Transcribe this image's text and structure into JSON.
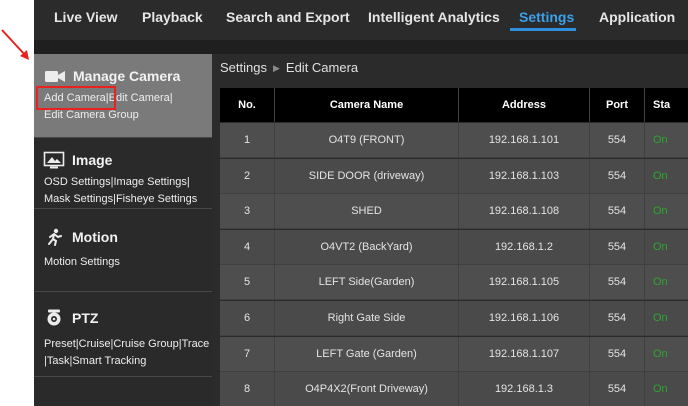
{
  "nav": {
    "items": [
      {
        "label": "Live View",
        "active": false
      },
      {
        "label": "Playback",
        "active": false
      },
      {
        "label": "Search and Export",
        "active": false
      },
      {
        "label": "Intelligent Analytics",
        "active": false
      },
      {
        "label": "Settings",
        "active": true
      },
      {
        "label": "Application",
        "active": false
      }
    ],
    "accent_color": "#2f8fdc"
  },
  "sidebar": {
    "sections": [
      {
        "title": "Manage Camera",
        "icon": "camera-icon",
        "active": true,
        "links": [
          "Add Camera",
          "Edit Camera",
          "Edit Camera Group"
        ]
      },
      {
        "title": "Image",
        "icon": "image-icon",
        "active": false,
        "links": [
          "OSD Settings",
          "Image Settings",
          "Mask Settings",
          "Fisheye Settings"
        ]
      },
      {
        "title": "Motion",
        "icon": "running-person-icon",
        "active": false,
        "links": [
          "Motion Settings"
        ]
      },
      {
        "title": "PTZ",
        "icon": "ptz-camera-icon",
        "active": false,
        "links": [
          "Preset",
          "Cruise",
          "Cruise Group",
          "Trace",
          "Task",
          "Smart Tracking"
        ]
      }
    ]
  },
  "breadcrumb": {
    "root": "Settings",
    "separator": "▶",
    "current": "Edit Camera"
  },
  "table": {
    "headers": [
      "No.",
      "Camera Name",
      "Address",
      "Port",
      "Sta"
    ],
    "rows": [
      {
        "no": "1",
        "name": "O4T9 (FRONT)",
        "address": "192.168.1.101",
        "port": "554",
        "status": "On"
      },
      {
        "no": "2",
        "name": "SIDE DOOR (driveway)",
        "address": "192.168.1.103",
        "port": "554",
        "status": "On"
      },
      {
        "no": "3",
        "name": "SHED",
        "address": "192.168.1.108",
        "port": "554",
        "status": "On"
      },
      {
        "no": "4",
        "name": "O4VT2 (BackYard)",
        "address": "192.168.1.2",
        "port": "554",
        "status": "On"
      },
      {
        "no": "5",
        "name": "LEFT Side(Garden)",
        "address": "192.168.1.105",
        "port": "554",
        "status": "On"
      },
      {
        "no": "6",
        "name": "Right Gate Side",
        "address": "192.168.1.106",
        "port": "554",
        "status": "On"
      },
      {
        "no": "7",
        "name": "LEFT Gate  (Garden)",
        "address": "192.168.1.107",
        "port": "554",
        "status": "On"
      },
      {
        "no": "8",
        "name": "O4P4X2(Front Driveway)",
        "address": "192.168.1.3",
        "port": "554",
        "status": "On"
      }
    ],
    "status_color": "#2ea62e"
  },
  "annotation": {
    "highlight_color": "#e8231f"
  }
}
